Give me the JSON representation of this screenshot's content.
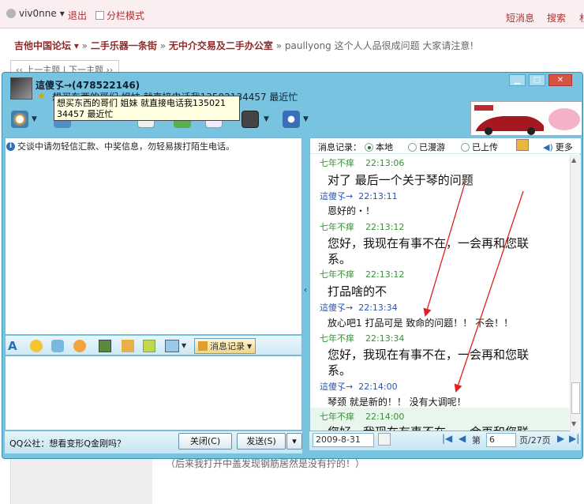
{
  "forum": {
    "username": "viv0nne",
    "logout": "退出",
    "split_mode": "分栏模式",
    "short_msg": "短消息",
    "search": "搜索",
    "more": "杉",
    "breadcrumb": {
      "site": "吉他中国论坛",
      "sep1": "»",
      "section": "二手乐器一条街",
      "sep2": "»",
      "subsection": "无中介交易及二手办公室",
      "sep3": "»",
      "thread": "paullyong 这个人人品很成问题 大家请注意!"
    },
    "prevnext": "‹‹ 上一主题 | 下一主题 ››",
    "bottom_note": "（后来我打开中盖发现钢筋居然是没有拧的！）"
  },
  "qq": {
    "contact_name": "這傻孓→(478522146)",
    "signature": "想买东西的哥们 姐妹 就直接电话我13502134457  最近忙",
    "tooltip_line1": "想买东西的哥们 姐妹 就直接电话我135021",
    "tooltip_line2": "34457 最近忙",
    "notice": "交谈中请勿轻信汇款、中奖信息，勿轻易拨打陌生电话。",
    "history_label": "消息记录：",
    "opt_local": "本地",
    "opt_roam": "已漫游",
    "opt_upload": "已上传",
    "more": "更多",
    "msg_history_btn": "消息记录",
    "qq_news": "QQ公社：想看变形Q金刚吗？",
    "close_btn": "关闭(C)",
    "send_btn": "发送(S)",
    "date": "2009-8-31",
    "page_prefix": "第",
    "page_num": "6",
    "page_suffix": "页/27页",
    "messages": [
      {
        "sender": "七年不痒",
        "time": "22:13:06",
        "text": "对了  最后一个关于琴的问题"
      },
      {
        "sender": "這傻孓→",
        "time": "22:13:11",
        "text": "恩好的・！"
      },
      {
        "sender": "七年不痒",
        "time": "22:13:12",
        "text": "您好，我现在有事不在，一会再和您联",
        "text2": "系。"
      },
      {
        "sender": "七年不痒",
        "time": "22:13:12",
        "text": "打品啥的不"
      },
      {
        "sender": "這傻孓→",
        "time": "22:13:34",
        "text": "放心吧1 打品可是 致命的问题！！  不会！！"
      },
      {
        "sender": "七年不痒",
        "time": "22:13:34",
        "text": "您好，我现在有事不在，一会再和您联",
        "text2": "系。"
      },
      {
        "sender": "這傻孓→",
        "time": "22:14:00",
        "text": "琴颈 就是新的！！ 没有大调呢！"
      },
      {
        "sender": "七年不痒",
        "time": "22:14:00",
        "text": "您好，我现在有事不在，一会再和您联"
      }
    ],
    "colors": {
      "window": "#78c3e0",
      "sender_other": "#3a8f3a",
      "sender_self": "#2a54b0",
      "arrow": "#e02020"
    }
  }
}
